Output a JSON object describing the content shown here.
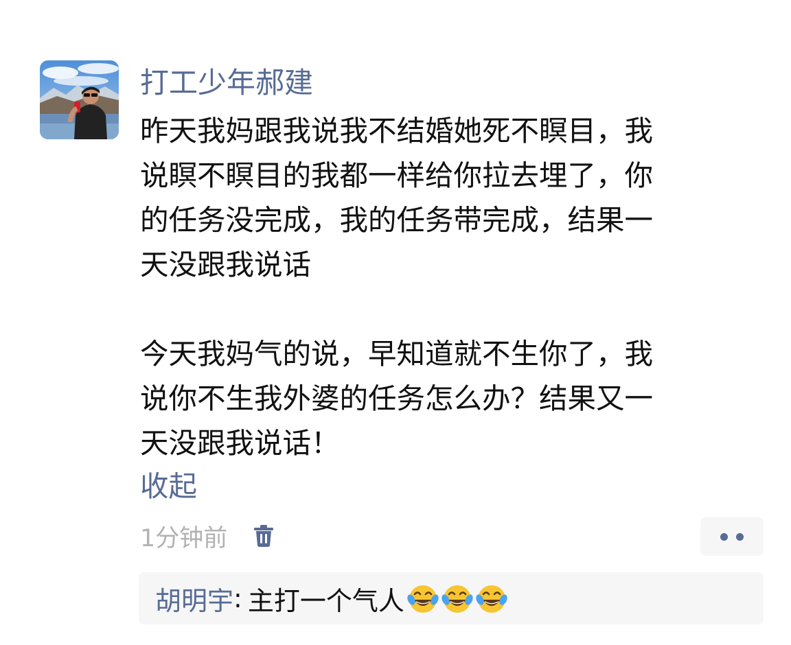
{
  "post": {
    "username": "打工少年郝建",
    "paragraphs": [
      [
        "昨天我妈跟我说我不结婚她死不瞑目，我",
        "说瞑不瞑目的我都一样给你拉去埋了，你",
        "的任务没完成，我的任务带完成，结果一",
        "天没跟我说话"
      ],
      [
        "今天我妈气的说，早知道就不生你了，我",
        "说你不生我外婆的任务怎么办？结果又一",
        "天没跟我说话！"
      ]
    ],
    "collapse_label": "收起",
    "timestamp": "1分钟前",
    "icons": {
      "delete": "trash-icon",
      "more": "more-dots-icon",
      "emoji": "tears-of-joy-emoji"
    }
  },
  "comments": [
    {
      "author": "胡明宇",
      "separator": ": ",
      "text": "主打一个气人",
      "emoji_count": 3
    }
  ],
  "colors": {
    "link": "#576b95",
    "text": "#111111",
    "timestamp": "#b2b2b2",
    "comment_bg": "#f6f6f6"
  }
}
